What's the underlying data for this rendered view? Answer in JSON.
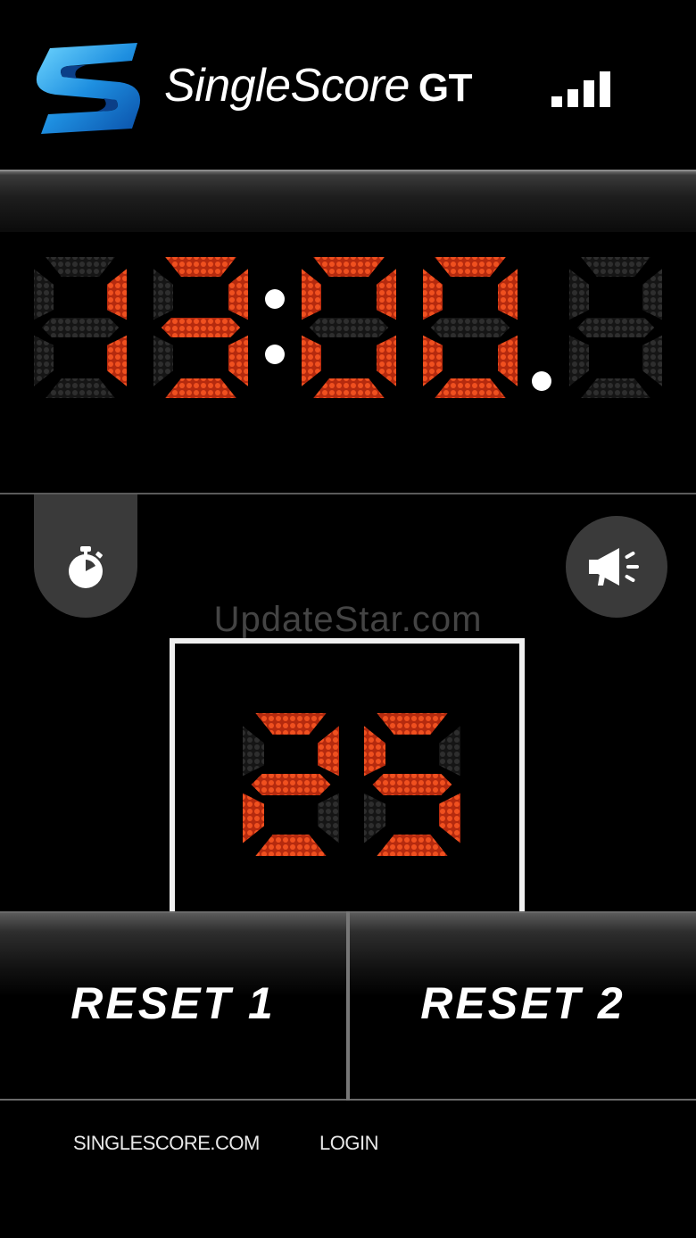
{
  "app": {
    "brand_name": "SingleScore",
    "brand_suffix": "GT",
    "signal_level": 4,
    "signal_bars_total": 4
  },
  "game_clock": {
    "display": "13:00.",
    "digits": [
      "8",
      "1",
      "3",
      "0",
      "0",
      "8"
    ],
    "lit": [
      false,
      true,
      true,
      true,
      true,
      false
    ],
    "lit_color": "#e8431b",
    "unlit_color": "#2a2a2a"
  },
  "controls": {
    "timer_icon": "stopwatch-icon",
    "horn_icon": "horn-icon"
  },
  "watermark": "UpdateStar.com",
  "shot_clock": {
    "display": "25",
    "digits": [
      "2",
      "5"
    ]
  },
  "buttons": {
    "reset_1": "RESET 1",
    "reset_2": "RESET 2"
  },
  "footer": {
    "link_site": "SINGLESCORE.COM",
    "link_login": "LOGIN"
  }
}
